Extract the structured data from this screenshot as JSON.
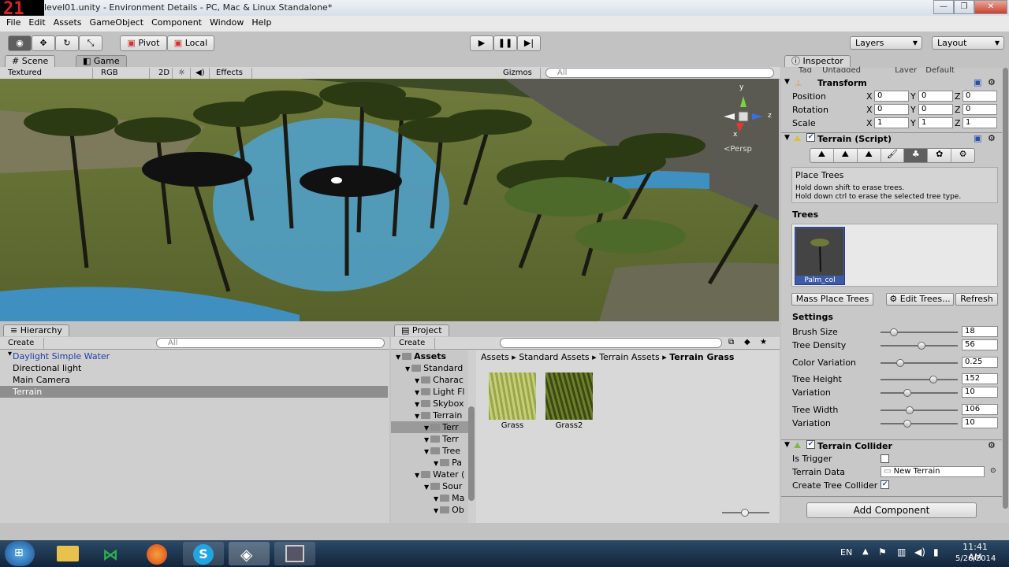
{
  "window": {
    "title": "level01.unity - Environment Details - PC, Mac & Linux Standalone*",
    "recorder": "21",
    "controls": [
      "—",
      "❐",
      "✕"
    ]
  },
  "menu": [
    "File",
    "Edit",
    "Assets",
    "GameObject",
    "Component",
    "Window",
    "Help"
  ],
  "toolbar": {
    "pivot": "Pivot",
    "local": "Local",
    "layers": "Layers",
    "layout": "Layout"
  },
  "scene": {
    "tab": "Scene",
    "game_tab": "Game",
    "shading": "Textured",
    "render": "RGB",
    "mode2d": "2D",
    "effects": "Effects",
    "gizmos": "Gizmos",
    "search_placeholder": "All",
    "persp": "<Persp",
    "axis": {
      "y": "y",
      "z": "z",
      "x": "x"
    }
  },
  "hierarchy": {
    "tab": "Hierarchy",
    "create": "Create",
    "search_placeholder": "All",
    "items": [
      "Daylight Simple Water",
      "Directional light",
      "Main Camera",
      "Terrain"
    ]
  },
  "project": {
    "tab": "Project",
    "create": "Create",
    "tree": [
      {
        "label": "Assets",
        "depth": 0,
        "bold": true
      },
      {
        "label": "Standard",
        "depth": 1
      },
      {
        "label": "Charac",
        "depth": 2
      },
      {
        "label": "Light Fl",
        "depth": 2
      },
      {
        "label": "Skybox",
        "depth": 2
      },
      {
        "label": "Terrain",
        "depth": 2
      },
      {
        "label": "Terr",
        "depth": 3,
        "selected": true
      },
      {
        "label": "Terr",
        "depth": 3
      },
      {
        "label": "Tree",
        "depth": 3
      },
      {
        "label": "Pa",
        "depth": 4
      },
      {
        "label": "Water (",
        "depth": 2
      },
      {
        "label": "Sour",
        "depth": 3
      },
      {
        "label": "Ma",
        "depth": 4
      },
      {
        "label": "Ob",
        "depth": 4
      }
    ],
    "breadcrumb": [
      "Assets",
      "Standard Assets",
      "Terrain Assets",
      "Terrain Grass"
    ],
    "assets": [
      "Grass",
      "Grass2"
    ]
  },
  "inspector": {
    "tab": "Inspector",
    "tag_label": "Tag",
    "tag_value": "Untagged",
    "layer_label": "Layer",
    "layer_value": "Default",
    "transform": {
      "title": "Transform",
      "rows": [
        {
          "label": "Position",
          "x": "0",
          "y": "0",
          "z": "0"
        },
        {
          "label": "Rotation",
          "x": "0",
          "y": "0",
          "z": "0"
        },
        {
          "label": "Scale",
          "x": "1",
          "y": "1",
          "z": "1"
        }
      ]
    },
    "terrain": {
      "title": "Terrain (Script)",
      "help_title": "Place Trees",
      "help_line1": "Hold down shift to erase trees.",
      "help_line2": "Hold down ctrl to erase the selected tree type.",
      "trees_header": "Trees",
      "tree_name": "Palm_col",
      "mass_place": "Mass Place Trees",
      "edit_trees": "Edit Trees...",
      "refresh": "Refresh",
      "settings_header": "Settings",
      "settings": [
        {
          "label": "Brush Size",
          "value": "18",
          "level": 0.17
        },
        {
          "label": "Tree Density",
          "value": "56",
          "level": 0.53
        },
        {
          "label": "Color Variation",
          "value": "0.25",
          "level": 0.25
        },
        {
          "label": "Tree Height",
          "value": "152",
          "level": 0.68
        },
        {
          "label": "Variation",
          "value": "10",
          "level": 0.35
        },
        {
          "label": "Tree Width",
          "value": "106",
          "level": 0.38
        },
        {
          "label": "Variation",
          "value": "10",
          "level": 0.35
        }
      ]
    },
    "collider": {
      "title": "Terrain Collider",
      "is_trigger": "Is Trigger",
      "terrain_data": "Terrain Data",
      "terrain_data_value": "New Terrain",
      "create_tree_collider": "Create Tree Collider"
    },
    "add_component": "Add Component"
  },
  "taskbar": {
    "lang": "EN",
    "time": "11:41 AM",
    "date": "5/26/2014"
  },
  "axes": {
    "x": "X",
    "y": "Y",
    "z": "Z"
  }
}
